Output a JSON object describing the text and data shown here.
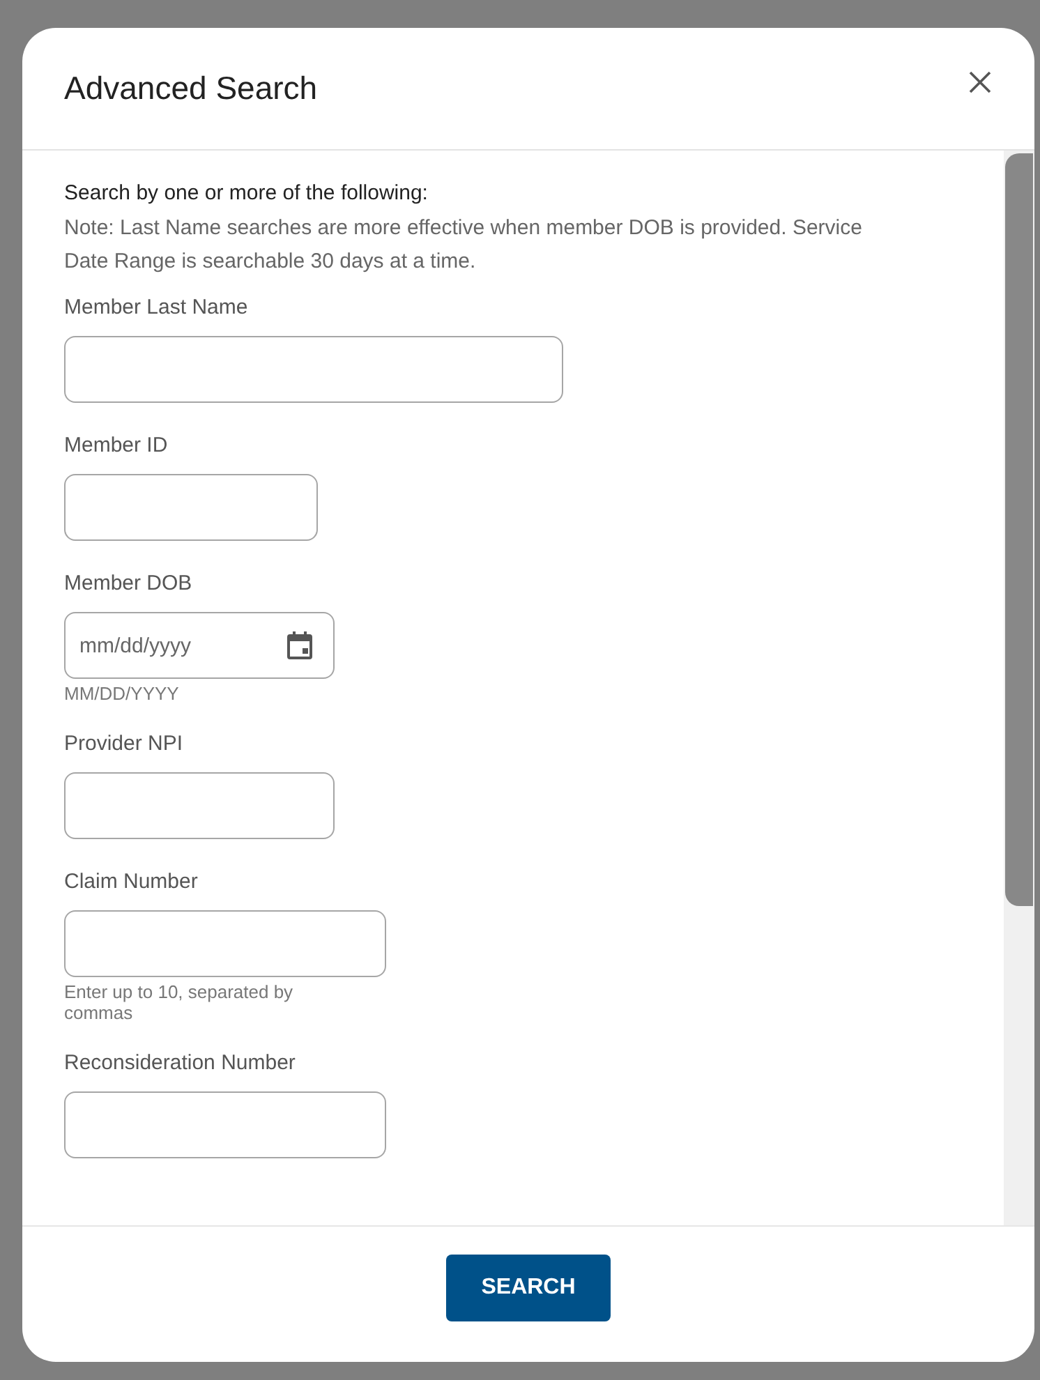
{
  "dialog": {
    "title": "Advanced Search",
    "intro": {
      "heading": "Search by one or more of the following:",
      "note": "Note: Last Name searches are more effective when member DOB is provided. Service Date Range is searchable 30 days at a time."
    },
    "fields": [
      {
        "kind": "text",
        "label": "Member Last Name"
      },
      {
        "kind": "text",
        "label": "Member ID"
      },
      {
        "kind": "date",
        "label": "Member DOB",
        "placeholder": "mm/dd/yyyy",
        "hint": "MM/DD/YYYY"
      },
      {
        "kind": "text",
        "label": "Provider NPI"
      },
      {
        "kind": "text",
        "label": "Claim Number",
        "hint": "Enter up to 10, separated by commas"
      },
      {
        "kind": "text",
        "label": "Reconsideration Number"
      }
    ],
    "button": "SEARCH"
  }
}
